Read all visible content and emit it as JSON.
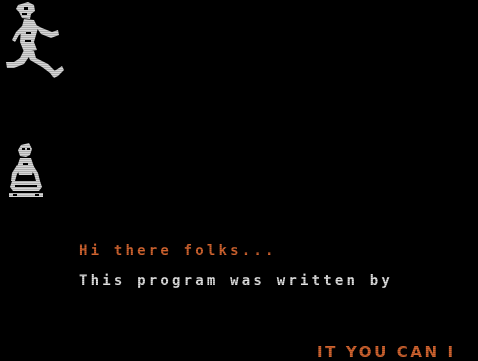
{
  "colors": {
    "background": "#000000",
    "accent_orange": "#d2642f",
    "text_white": "#e2e2e2",
    "sprite_grey": "#d6d6d6"
  },
  "sprites": {
    "runner": "running-figure-icon",
    "sitter": "seated-figure-icon"
  },
  "intro": {
    "greeting": "Hi there folks...",
    "credit_line": "This program was written by"
  },
  "scroller": {
    "text": "IT YOU CAN I"
  }
}
